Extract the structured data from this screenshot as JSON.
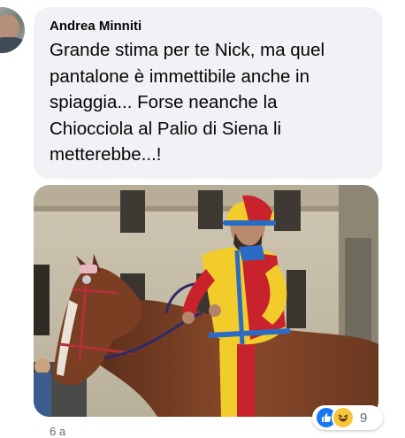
{
  "comment": {
    "author": "Andrea Minniti",
    "text": "Grande stima per te Nick, ma quel pantalone è immettibile anche in spiaggia... Forse neanche la Chiocciola al Palio di Siena li metterebbe...!",
    "lines": [
      "Grande stima per te Nick, ma quel",
      "pantalone è immettibile anche in",
      "spiaggia... Forse neanche la",
      "Chiocciola al Palio di Siena li",
      "metterebbe...!"
    ],
    "timestamp": "6 a",
    "attachment": {
      "description": "photo",
      "subject": "Palio di Siena jockey on horse"
    },
    "reactions": {
      "icons": [
        "like-icon",
        "haha-icon"
      ],
      "count": "9"
    }
  },
  "colors": {
    "bubble_bg": "#f0f2f5",
    "text": "#050505",
    "secondary_text": "#65676b",
    "like_blue": "#1877f2",
    "haha_yellow": "#f7c537"
  }
}
